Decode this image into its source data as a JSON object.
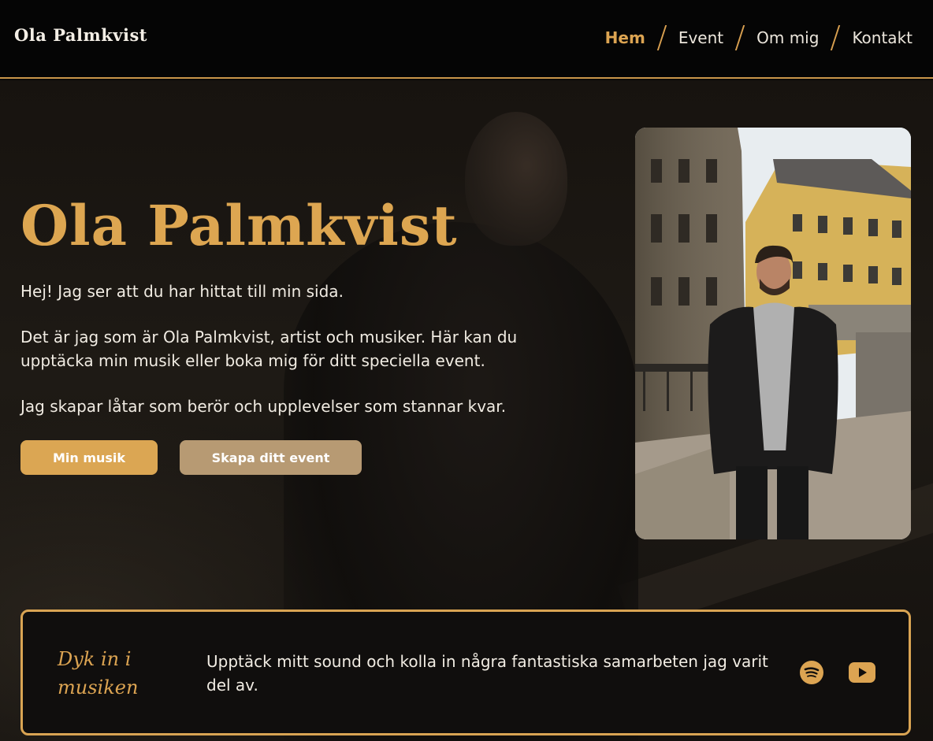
{
  "header": {
    "logo": "Ola Palmkvist",
    "nav": [
      {
        "label": "Hem",
        "active": true
      },
      {
        "label": "Event",
        "active": false
      },
      {
        "label": "Om mig",
        "active": false
      },
      {
        "label": "Kontakt",
        "active": false
      }
    ]
  },
  "hero": {
    "title": "Ola Palmkvist",
    "paragraphs": [
      "Hej! Jag ser att du har hittat till min sida.",
      "Det är jag som är Ola Palmkvist, artist och musiker. Här kan du upptäcka min musik eller boka mig för ditt speciella event.",
      "Jag skapar låtar som berör och upplevelser som stannar kvar."
    ],
    "buttons": {
      "music": "Min musik",
      "event": "Skapa ditt event"
    }
  },
  "music": {
    "heading": "Dyk in i musiken",
    "text": "Upptäck mitt sound och kolla in några fantastiska samarbeten jag varit del av.",
    "icons": [
      "spotify-icon",
      "youtube-icon"
    ]
  },
  "colors": {
    "accent": "#dca452",
    "accent_muted": "#b79a73",
    "background": "#0b0a09",
    "text": "#f1ece3"
  }
}
